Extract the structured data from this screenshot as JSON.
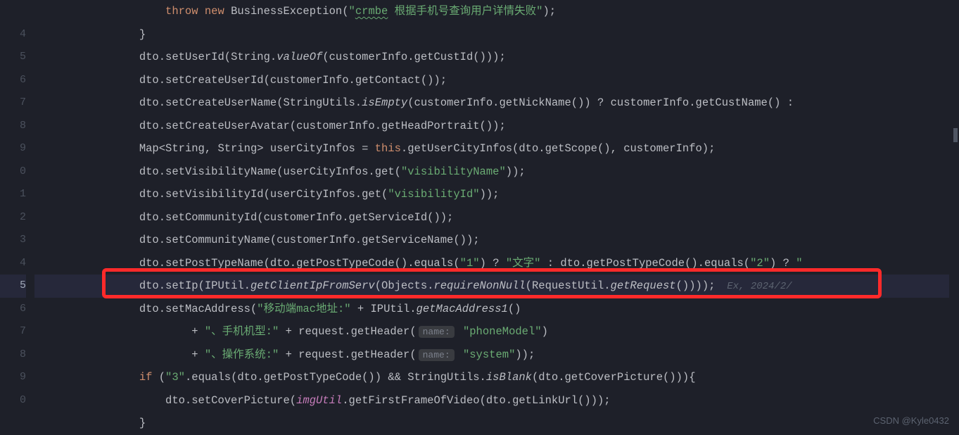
{
  "gutter": [
    "",
    "4",
    "5",
    "6",
    "7",
    "8",
    "9",
    "0",
    "1",
    "2",
    "3",
    "4",
    "5",
    "6",
    "7",
    "8",
    "9",
    "0",
    ""
  ],
  "code": {
    "l0": {
      "indent": "                    ",
      "kw1": "throw",
      "sp1": " ",
      "kw2": "new",
      "sp2": " ",
      "cls": "BusinessException",
      "op": "(",
      "s1": "\"",
      "s2": "crmbe",
      "s3": " 根据手机号查询用户详情失败\"",
      "cp": ");"
    },
    "l1": {
      "indent": "                ",
      "brace": "}"
    },
    "l2": {
      "indent": "                ",
      "obj": "dto.",
      "m1": "setUserId",
      "op": "(String.",
      "m2": "valueOf",
      "m3": "(customerInfo.",
      "m4": "getCustId",
      "m5": "()));"
    },
    "l3": {
      "indent": "                ",
      "obj": "dto.",
      "m1": "setCreateUserId",
      "m2": "(customerInfo.",
      "m3": "getContact",
      "m4": "());"
    },
    "l4": {
      "indent": "                ",
      "obj": "dto.",
      "m1": "setCreateUserName",
      "op": "(StringUtils.",
      "m2": "isEmpty",
      "m3": "(customerInfo.",
      "m4": "getNickName",
      "m5": "()) ? customerInfo.",
      "m6": "getCustName",
      "m7": "() : "
    },
    "l5": {
      "indent": "                ",
      "obj": "dto.",
      "m1": "setCreateUserAvatar",
      "m2": "(customerInfo.",
      "m3": "getHeadPortrait",
      "m4": "());"
    },
    "l6": {
      "indent": "                ",
      "t1": "Map<String, String> ",
      "var": "userCityInfos",
      "eq": " = ",
      "kw": "this",
      "dot": ".",
      "m1": "getUserCityInfos",
      "op": "(dto.",
      "m2": "getScope",
      "m3": "(), customerInfo);"
    },
    "l7": {
      "indent": "                ",
      "obj": "dto.",
      "m1": "setVisibilityName",
      "op": "(userCityInfos.",
      "m2": "get",
      "m3": "(",
      "s": "\"visibilityName\"",
      "cp": "));"
    },
    "l8": {
      "indent": "                ",
      "obj": "dto.",
      "m1": "setVisibilityId",
      "op": "(userCityInfos.",
      "m2": "get",
      "m3": "(",
      "s": "\"visibilityId\"",
      "cp": "));"
    },
    "l9": {
      "indent": "                ",
      "obj": "dto.",
      "m1": "setCommunityId",
      "m2": "(customerInfo.",
      "m3": "getServiceId",
      "m4": "());"
    },
    "l10": {
      "indent": "                ",
      "obj": "dto.",
      "m1": "setCommunityName",
      "m2": "(customerInfo.",
      "m3": "getServiceName",
      "m4": "());"
    },
    "l11": {
      "indent": "                ",
      "obj": "dto.",
      "m1": "setPostTypeName",
      "op": "(dto.",
      "m2": "getPostTypeCode",
      "m3": "().",
      "m4": "equals",
      "m5": "(",
      "s1": "\"",
      "s2": "1",
      "s3": "\"",
      "m6": ") ? ",
      "s4": "\"文字\"",
      "m7": " : dto.",
      "m8": "getPostTypeCode",
      "m9": "().",
      "m10": "equals",
      "m11": "(",
      "s5": "\"",
      "s6": "2",
      "s7": "\"",
      "m12": ") ? ",
      "s8": "\""
    },
    "l12": {
      "indent": "                ",
      "obj": "dto.",
      "m1": "setIp",
      "op": "(IPUtil.",
      "m2": "getClientIpFromServ",
      "m3": "(Objects.",
      "m4": "requireNonNull",
      "m5": "(RequestUtil.",
      "m6": "getRequest",
      "m7": "())));",
      "inlay": "  Ex, 2024/2/"
    },
    "l13": {
      "indent": "                ",
      "obj": "dto.",
      "m1": "setMacAddress",
      "op": "(",
      "s": "\"移动端mac地址:\"",
      "plus": " + IPUtil.",
      "m2": "getMacAddress1",
      "cp": "()"
    },
    "l14": {
      "indent": "                        ",
      "plus": "+ ",
      "s": "\"、手机机型:\"",
      "p2": " + request.",
      "m1": "getHeader",
      "op": "(",
      "hint": "name:",
      "sp": " ",
      "s2": "\"phoneModel\"",
      "cp": ")"
    },
    "l15": {
      "indent": "                        ",
      "plus": "+ ",
      "s": "\"、操作系统:\"",
      "p2": " + request.",
      "m1": "getHeader",
      "op": "(",
      "hint": "name:",
      "sp": " ",
      "s2": "\"system\"",
      "cp": "));"
    },
    "l16": {
      "indent": "                ",
      "kw": "if",
      "sp": " (",
      "s": "\"3\"",
      "dot": ".",
      "m1": "equals",
      "op": "(dto.",
      "m2": "getPostTypeCode",
      "m3": "()) && StringUtils.",
      "m4": "isBlank",
      "m5": "(dto.",
      "m6": "getCoverPicture",
      "m7": "())){"
    },
    "l17": {
      "indent": "                    ",
      "obj": "dto.",
      "m1": "setCoverPicture",
      "op": "(",
      "fld": "imgUtil",
      "dot": ".",
      "m2": "getFirstFrameOfVideo",
      "m3": "(dto.",
      "m4": "getLinkUrl",
      "m5": "()));"
    },
    "l18": {
      "indent": "                ",
      "brace": "}"
    }
  },
  "watermark": "CSDN @Kyle0432"
}
